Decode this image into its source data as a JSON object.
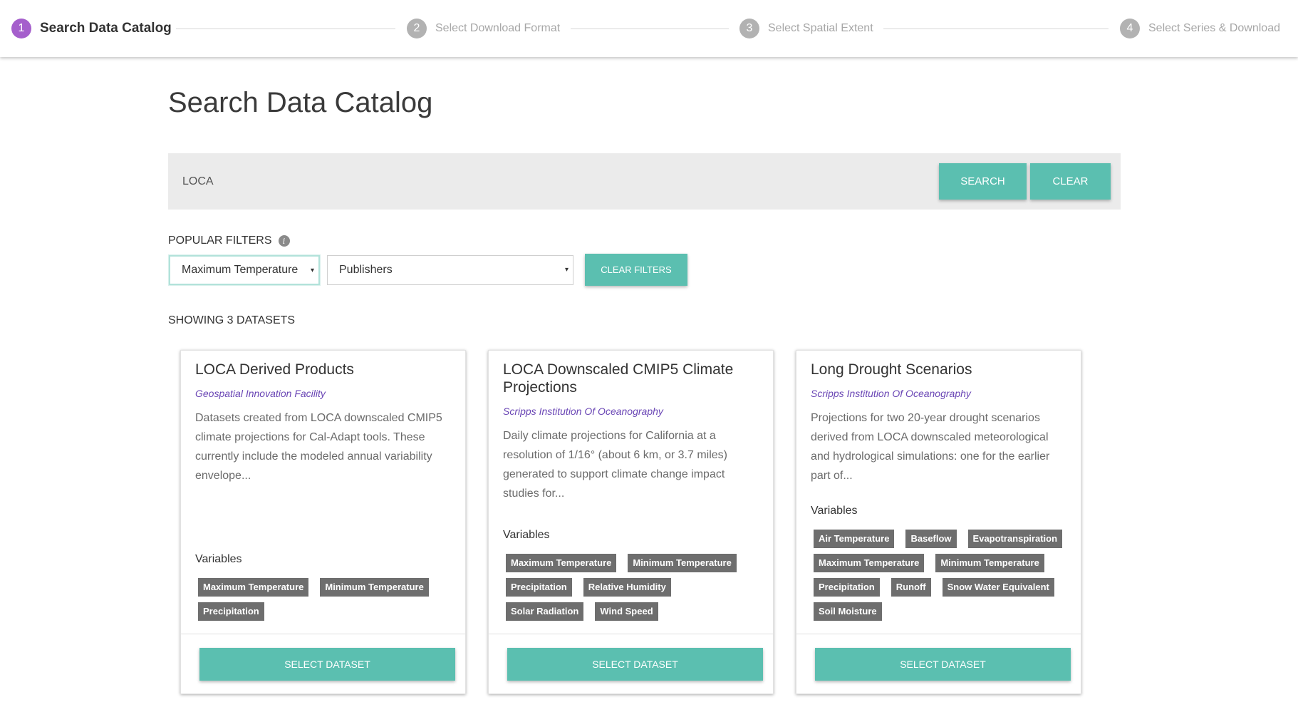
{
  "stepper": {
    "steps": [
      {
        "num": "1",
        "label": "Search Data Catalog"
      },
      {
        "num": "2",
        "label": "Select Download Format"
      },
      {
        "num": "3",
        "label": "Select Spatial Extent"
      },
      {
        "num": "4",
        "label": "Select Series & Download"
      }
    ]
  },
  "page": {
    "title": "Search Data Catalog"
  },
  "search": {
    "value": "LOCA",
    "search_label": "SEARCH",
    "clear_label": "CLEAR"
  },
  "filters": {
    "label": "POPULAR FILTERS",
    "info_glyph": "i",
    "variable_selected": "Maximum Temperature",
    "publisher_selected": "Publishers",
    "caret": "▾",
    "clear_label": "CLEAR FILTERS"
  },
  "results": {
    "showing": "SHOWING 3 DATASETS"
  },
  "cards": [
    {
      "title": "LOCA Derived Products",
      "publisher": "Geospatial Innovation Facility",
      "description": "Datasets created from LOCA downscaled CMIP5 climate projections for Cal-Adapt tools. These currently include the modeled annual variability envelope...",
      "variables_title": "Variables",
      "variables": [
        "Maximum Temperature",
        "Minimum Temperature",
        "Precipitation"
      ],
      "button": "SELECT DATASET"
    },
    {
      "title": "LOCA Downscaled CMIP5 Climate Projections",
      "publisher": "Scripps Institution Of Oceanography",
      "description": "Daily climate projections for California at a resolution of 1/16° (about 6 km, or 3.7 miles) generated to support climate change impact studies for...",
      "variables_title": "Variables",
      "variables": [
        "Maximum Temperature",
        "Minimum Temperature",
        "Precipitation",
        "Relative Humidity",
        "Solar Radiation",
        "Wind Speed"
      ],
      "button": "SELECT DATASET"
    },
    {
      "title": "Long Drought Scenarios",
      "publisher": "Scripps Institution Of Oceanography",
      "description": "Projections for two 20-year drought scenarios derived from LOCA downscaled meteorological and hydrological simulations: one for the earlier part of...",
      "variables_title": "Variables",
      "variables": [
        "Air Temperature",
        "Baseflow",
        "Evapotranspiration",
        "Maximum Temperature",
        "Minimum Temperature",
        "Precipitation",
        "Runoff",
        "Snow Water Equivalent",
        "Soil Moisture"
      ],
      "button": "SELECT DATASET"
    }
  ],
  "colors": {
    "accent": "#5bbfb0",
    "active_step": "#a55fcc",
    "publisher": "#6a46b5",
    "tag": "#6e6e6e"
  }
}
